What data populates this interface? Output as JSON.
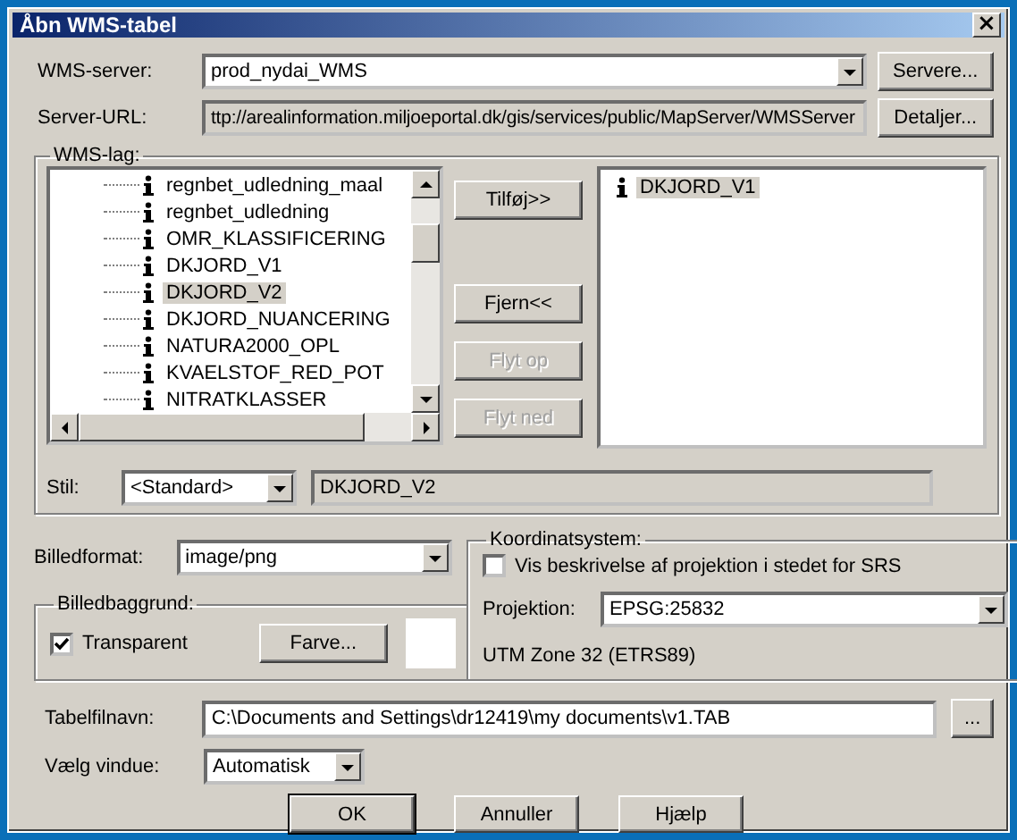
{
  "window": {
    "title": "Åbn WMS-tabel",
    "close": "×"
  },
  "server": {
    "label": "WMS-server:",
    "value": "prod_nydai_WMS",
    "button": "Servere..."
  },
  "url": {
    "label": "Server-URL:",
    "value": "ttp://arealinformation.miljoeportal.dk/gis/services/public/MapServer/WMSServer",
    "button": "Detaljer..."
  },
  "layers": {
    "title": "WMS-lag:",
    "tree": [
      {
        "label": "regnbet_udledning_maal",
        "selected": false
      },
      {
        "label": "regnbet_udledning",
        "selected": false
      },
      {
        "label": "OMR_KLASSIFICERING",
        "selected": false
      },
      {
        "label": "DKJORD_V1",
        "selected": false
      },
      {
        "label": "DKJORD_V2",
        "selected": true
      },
      {
        "label": "DKJORD_NUANCERING",
        "selected": false
      },
      {
        "label": "NATURA2000_OPL",
        "selected": false
      },
      {
        "label": "KVAELSTOF_RED_POT",
        "selected": false
      },
      {
        "label": "NITRATKLASSER",
        "selected": false
      }
    ],
    "buttons": [
      {
        "label": "Tilføj>>",
        "disabled": false
      },
      {
        "label": "Fjern<<",
        "disabled": false
      },
      {
        "label": "Flyt op",
        "disabled": true
      },
      {
        "label": "Flyt ned",
        "disabled": true
      }
    ],
    "chosen": [
      {
        "label": "DKJORD_V1",
        "selected": true
      }
    ],
    "style": {
      "label": "Stil:",
      "value": "<Standard>"
    },
    "style_name": "DKJORD_V2"
  },
  "image_format": {
    "label": "Billedformat:",
    "value": "image/png"
  },
  "background": {
    "title": "Billedbaggrund:",
    "transparent": {
      "label": "Transparent",
      "checked": true
    },
    "button": "Farve..."
  },
  "coords": {
    "title": "Koordinatsystem:",
    "describe": {
      "label": "Vis beskrivelse af projektion i stedet for SRS",
      "checked": false
    },
    "projection": {
      "label": "Projektion:",
      "value": "EPSG:25832"
    },
    "description": "UTM Zone 32 (ETRS89)"
  },
  "table_file": {
    "label": "Tabelfilnavn:",
    "value": "C:\\Documents and Settings\\dr12419\\my documents\\v1.TAB",
    "browse": "..."
  },
  "window_select": {
    "label": "Vælg vindue:",
    "value": "Automatisk"
  },
  "buttons": [
    {
      "label": "OK",
      "default": true
    },
    {
      "label": "Annuller",
      "default": false
    },
    {
      "label": "Hjælp",
      "default": false
    }
  ]
}
